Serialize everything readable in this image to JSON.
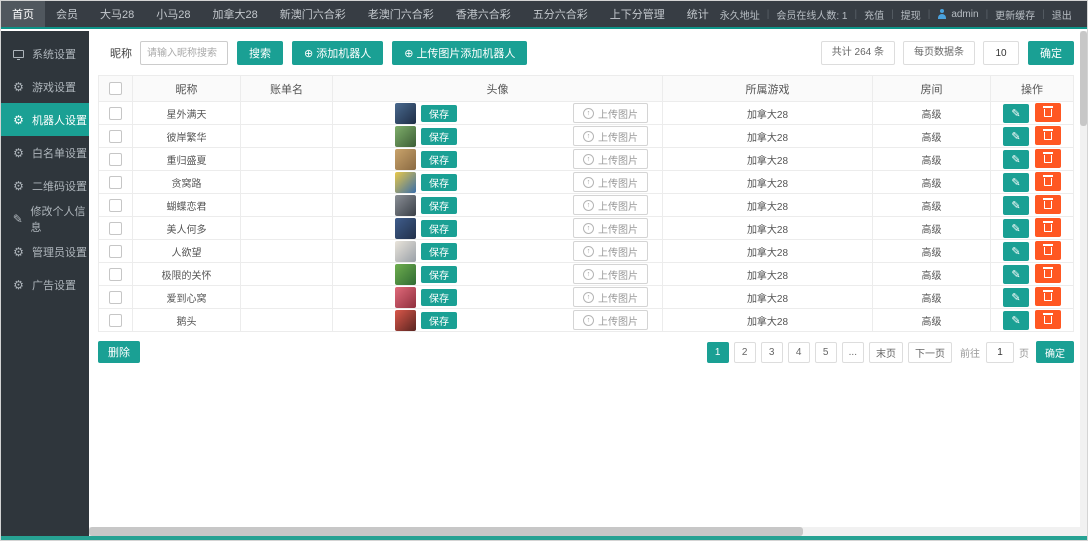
{
  "topbar": {
    "nav": [
      {
        "label": "首页",
        "active": true
      },
      {
        "label": "会员"
      },
      {
        "label": "大马28"
      },
      {
        "label": "小马28"
      },
      {
        "label": "加拿大28"
      },
      {
        "label": "新澳门六合彩"
      },
      {
        "label": "老澳门六合彩"
      },
      {
        "label": "香港六合彩"
      },
      {
        "label": "五分六合彩"
      },
      {
        "label": "上下分管理"
      },
      {
        "label": "统计"
      }
    ],
    "right": {
      "site_link": "永久地址",
      "online_label": "会员在线人数: 1",
      "recharge": "充值",
      "withdraw": "提现",
      "username": "admin",
      "refresh_cache": "更新缓存",
      "logout": "退出"
    }
  },
  "sidebar": {
    "items": [
      {
        "label": "系统设置",
        "icon": "monitor-icon"
      },
      {
        "label": "游戏设置",
        "icon": "gear-icon"
      },
      {
        "label": "机器人设置",
        "icon": "gear-icon",
        "active": true
      },
      {
        "label": "白名单设置",
        "icon": "gear-icon"
      },
      {
        "label": "二维码设置",
        "icon": "gear-icon"
      },
      {
        "label": "修改个人信息",
        "icon": "pencil-icon"
      },
      {
        "label": "管理员设置",
        "icon": "gear-icon"
      },
      {
        "label": "广告设置",
        "icon": "gear-icon"
      }
    ]
  },
  "toolbar": {
    "nickname_label": "昵称",
    "search_placeholder": "请输入昵称搜索",
    "search_button": "搜索",
    "add_robot_button": "添加机器人",
    "upload_add_robot_button": "上传图片添加机器人",
    "total_count": "共计 264 条",
    "per_page_label": "每页数据条",
    "per_page_value": "10",
    "confirm_button": "确定"
  },
  "table": {
    "headers": [
      "昵称",
      "账单名",
      "头像",
      "所属游戏",
      "房间",
      "操作"
    ],
    "save_button": "保存",
    "upload_button": "上传图片",
    "rows": [
      {
        "nickname": "星外满天",
        "account": "",
        "game": "加拿大28",
        "room": "高级",
        "avatar": [
          "#4a6a8f",
          "#1e2d45"
        ]
      },
      {
        "nickname": "彼岸繁华",
        "account": "",
        "game": "加拿大28",
        "room": "高级",
        "avatar": [
          "#7fae6b",
          "#3c5e35"
        ]
      },
      {
        "nickname": "重归盛夏",
        "account": "",
        "game": "加拿大28",
        "room": "高级",
        "avatar": [
          "#c9a36b",
          "#8a6a42"
        ]
      },
      {
        "nickname": "贪窝路",
        "account": "",
        "game": "加拿大28",
        "room": "高级",
        "avatar": [
          "#e8c84a",
          "#3a6ea8"
        ]
      },
      {
        "nickname": "蝴蝶恋君",
        "account": "",
        "game": "加拿大28",
        "room": "高级",
        "avatar": [
          "#8a8f96",
          "#3a3f47"
        ]
      },
      {
        "nickname": "美人何多",
        "account": "",
        "game": "加拿大28",
        "room": "高级",
        "avatar": [
          "#3f5d8c",
          "#22304a"
        ]
      },
      {
        "nickname": "人欲望",
        "account": "",
        "game": "加拿大28",
        "room": "高级",
        "avatar": [
          "#e9e4da",
          "#9aa0a8"
        ]
      },
      {
        "nickname": "极限的关怀",
        "account": "",
        "game": "加拿大28",
        "room": "高级",
        "avatar": [
          "#6fae4f",
          "#2f6b33"
        ]
      },
      {
        "nickname": "爱到心窝",
        "account": "",
        "game": "加拿大28",
        "room": "高级",
        "avatar": [
          "#e06a7a",
          "#8f2f3e"
        ]
      },
      {
        "nickname": "鹅头",
        "account": "",
        "game": "加拿大28",
        "room": "高级",
        "avatar": [
          "#d9574a",
          "#5a2420"
        ]
      }
    ]
  },
  "footer": {
    "delete_button": "删除",
    "pagination": {
      "pages": [
        "1",
        "2",
        "3",
        "4",
        "5",
        "..."
      ],
      "active_page": "1",
      "last_label": "末页",
      "next_label": "下一页",
      "goto_label": "前往",
      "goto_value": "1",
      "unit_label": "页",
      "confirm_label": "确定"
    }
  },
  "colors": {
    "accent": "#1aa094",
    "accent_line": "#0d9488",
    "danger": "#ff5722",
    "topbar_bg": "#373d44",
    "sidebar_bg": "#2f363c"
  }
}
